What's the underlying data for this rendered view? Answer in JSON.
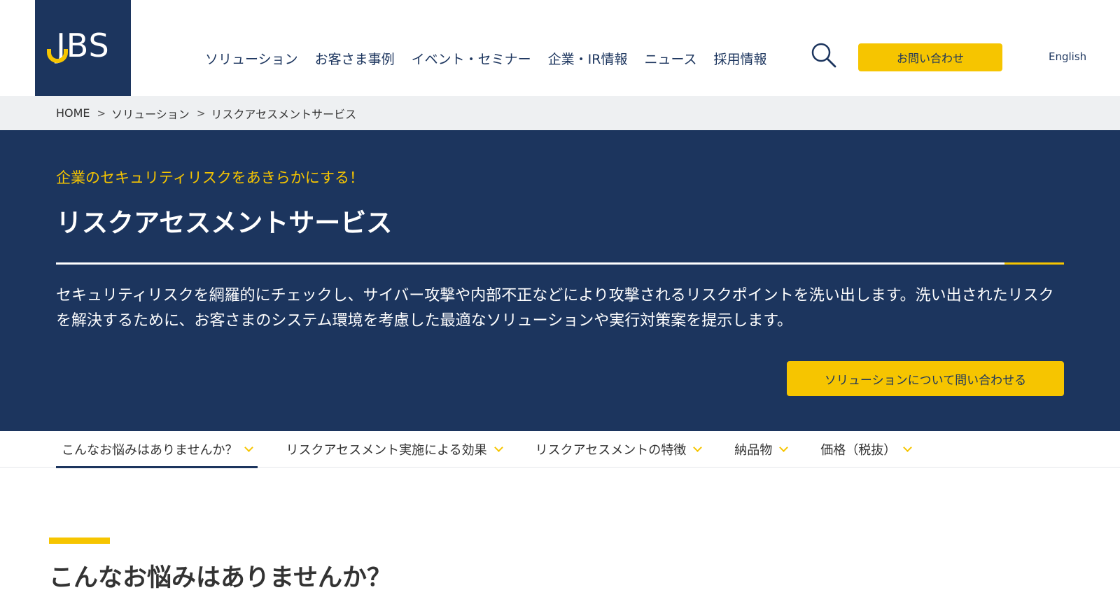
{
  "header": {
    "logo_text": "JBS",
    "nav": [
      {
        "label": "ソリューション"
      },
      {
        "label": "お客さま事例"
      },
      {
        "label": "イベント・セミナー"
      },
      {
        "label": "企業・IR情報"
      },
      {
        "label": "ニュース"
      },
      {
        "label": "採用情報"
      }
    ],
    "search_icon": "search-icon",
    "contact_label": "お問い合わせ",
    "english_label": "English"
  },
  "breadcrumb": {
    "items": [
      "HOME",
      "ソリューション",
      "リスクアセスメントサービス"
    ],
    "separator": ">"
  },
  "hero": {
    "subtitle": "企業のセキュリティリスクをあきらかにする！",
    "title": "リスクアセスメントサービス",
    "description": "セキュリティリスクを網羅的にチェックし、サイバー攻撃や内部不正などにより攻撃されるリスクポイントを洗い出します。洗い出されたリスクを解決するために、お客さまのシステム環境を考慮した最適なソリューションや実行対策案を提示します。",
    "cta_label": "ソリューションについて問い合わせる"
  },
  "anchor_tabs": [
    {
      "label": "こんなお悩みはありませんか？",
      "active": true
    },
    {
      "label": "リスクアセスメント実施による効果",
      "active": false
    },
    {
      "label": "リスクアセスメントの特徴",
      "active": false
    },
    {
      "label": "納品物",
      "active": false
    },
    {
      "label": "価格（税抜）",
      "active": false
    }
  ],
  "section": {
    "title": "こんなお悩みはありませんか？"
  },
  "colors": {
    "navy": "#1c355e",
    "accent_yellow": "#f6c500",
    "breadcrumb_bg": "#eef0f2"
  }
}
